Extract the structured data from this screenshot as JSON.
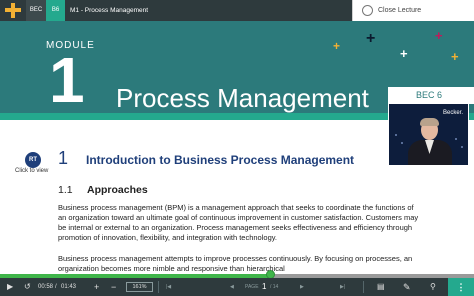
{
  "topbar": {
    "course_tag": "BEC",
    "section_tag": "B6",
    "module_title": "M1 - Process Management",
    "close_label": "Close Lecture"
  },
  "banner": {
    "module_label": "MODULE",
    "module_number": "1",
    "title": "Process Management",
    "accent_colors": [
      "#f2b134",
      "#0b1a2e",
      "#ffffff",
      "#c2185b"
    ]
  },
  "video": {
    "badge": "BEC 6",
    "brand": "Becker."
  },
  "content": {
    "rt_icon": "RT",
    "rt_caption": "Click to view",
    "section_number": "1",
    "section_title": "Introduction to Business Process Management",
    "subsection_number": "1.1",
    "subsection_title": "Approaches",
    "paragraph1": "Business process management (BPM) is a management approach that seeks to coordinate the functions of an organization toward an ultimate goal of continuous improvement in customer satisfaction. Customers may be internal or external to an organization. Process management seeks effectiveness and efficiency through promotion of innovation, flexibility, and integration with technology.",
    "paragraph2": "Business process management attempts to improve processes continuously. By focusing on processes, an organization becomes more nimble and responsive than hierarchical"
  },
  "player": {
    "progress": 0.57,
    "current_time": "00:58",
    "total_time": "01:43",
    "zoom": "161%",
    "page_label": "PAGE",
    "page_number": "1",
    "page_total": "/ 14",
    "colors": {
      "progress": "#3fb54a",
      "bar": "#2e3a3d",
      "accent": "#24a98e"
    }
  }
}
